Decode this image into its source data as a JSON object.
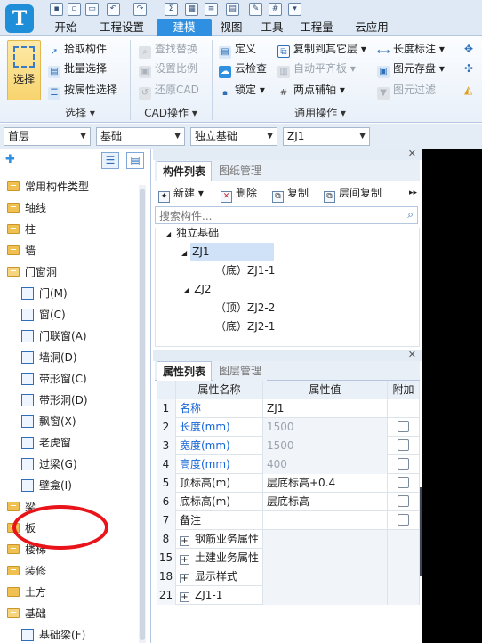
{
  "app": {
    "logo_letter": "T"
  },
  "tabs": [
    {
      "label": "开始"
    },
    {
      "label": "工程设置"
    },
    {
      "label": "建模",
      "active": true
    },
    {
      "label": "视图"
    },
    {
      "label": "工具"
    },
    {
      "label": "工程量"
    },
    {
      "label": "云应用"
    }
  ],
  "ribbon": {
    "select_label": "选择",
    "select_group": {
      "items": [
        "拾取构件",
        "批量选择",
        "按属性选择"
      ],
      "label": "选择"
    },
    "cad_group": {
      "items": [
        "查找替换",
        "设置比例",
        "还原CAD"
      ],
      "label": "CAD操作"
    },
    "common_group": {
      "col1": [
        "定义",
        "云检查",
        "锁定"
      ],
      "col2": [
        "复制到其它层",
        "自动平齐板",
        "两点辅轴"
      ],
      "col3": [
        "长度标注",
        "图元存盘",
        "图元过滤"
      ],
      "label": "通用操作"
    }
  },
  "combos": {
    "floor": "首层",
    "category": "基础",
    "type": "独立基础",
    "element": "ZJ1"
  },
  "left_tree": [
    {
      "label": "常用构件类型",
      "kind": "folder"
    },
    {
      "label": "轴线",
      "kind": "folder"
    },
    {
      "label": "柱",
      "kind": "folder"
    },
    {
      "label": "墙",
      "kind": "folder"
    },
    {
      "label": "门窗洞",
      "kind": "folder-open"
    },
    {
      "label": "门(M)",
      "kind": "child"
    },
    {
      "label": "窗(C)",
      "kind": "child"
    },
    {
      "label": "门联窗(A)",
      "kind": "child"
    },
    {
      "label": "墙洞(D)",
      "kind": "child"
    },
    {
      "label": "带形窗(C)",
      "kind": "child"
    },
    {
      "label": "带形洞(D)",
      "kind": "child"
    },
    {
      "label": "飘窗(X)",
      "kind": "child"
    },
    {
      "label": "老虎窗",
      "kind": "child"
    },
    {
      "label": "过梁(G)",
      "kind": "child"
    },
    {
      "label": "壁龛(I)",
      "kind": "child"
    },
    {
      "label": "梁",
      "kind": "folder"
    },
    {
      "label": "板",
      "kind": "folder"
    },
    {
      "label": "楼梯",
      "kind": "folder"
    },
    {
      "label": "装修",
      "kind": "folder"
    },
    {
      "label": "土方",
      "kind": "folder"
    },
    {
      "label": "基础",
      "kind": "folder-open"
    },
    {
      "label": "基础梁(F)",
      "kind": "child"
    }
  ],
  "component_panel": {
    "tabs": [
      "构件列表",
      "图纸管理"
    ],
    "toolbar": [
      "新建",
      "删除",
      "复制",
      "层间复制"
    ],
    "search_placeholder": "搜索构件...",
    "tree": [
      {
        "label": "独立基础",
        "level": 0
      },
      {
        "label": "ZJ1",
        "level": 1,
        "selected": true
      },
      {
        "label": "（底）ZJ1-1",
        "level": 2
      },
      {
        "label": "ZJ2",
        "level": 1
      },
      {
        "label": "（顶）ZJ2-2",
        "level": 2
      },
      {
        "label": "（底）ZJ2-1",
        "level": 2
      }
    ]
  },
  "property_panel": {
    "tabs": [
      "属性列表",
      "图层管理"
    ],
    "headers": {
      "name": "属性名称",
      "value": "属性值",
      "add": "附加"
    },
    "rows": [
      {
        "num": "1",
        "name": "名称",
        "value": "ZJ1",
        "name_blue": true,
        "value_gray": false,
        "checkbox": false,
        "expandable": false
      },
      {
        "num": "2",
        "name": "长度(mm)",
        "value": "1500",
        "name_blue": true,
        "value_gray": true,
        "checkbox": true,
        "expandable": false
      },
      {
        "num": "3",
        "name": "宽度(mm)",
        "value": "1500",
        "name_blue": true,
        "value_gray": true,
        "checkbox": true,
        "expandable": false
      },
      {
        "num": "4",
        "name": "高度(mm)",
        "value": "400",
        "name_blue": true,
        "value_gray": true,
        "checkbox": true,
        "expandable": false
      },
      {
        "num": "5",
        "name": "顶标高(m)",
        "value": "层底标高+0.4",
        "name_blue": false,
        "value_gray": false,
        "checkbox": true,
        "expandable": false
      },
      {
        "num": "6",
        "name": "底标高(m)",
        "value": "层底标高",
        "name_blue": false,
        "value_gray": false,
        "checkbox": true,
        "expandable": false
      },
      {
        "num": "7",
        "name": "备注",
        "value": "",
        "name_blue": false,
        "value_gray": false,
        "checkbox": true,
        "expandable": false
      },
      {
        "num": "8",
        "name": "钢筋业务属性",
        "value": "",
        "name_blue": false,
        "value_gray": false,
        "checkbox": false,
        "expandable": true
      },
      {
        "num": "15",
        "name": "土建业务属性",
        "value": "",
        "name_blue": false,
        "value_gray": false,
        "checkbox": false,
        "expandable": true
      },
      {
        "num": "18",
        "name": "显示样式",
        "value": "",
        "name_blue": false,
        "value_gray": false,
        "checkbox": false,
        "expandable": true
      },
      {
        "num": "21",
        "name": "ZJ1-1",
        "value": "",
        "name_blue": false,
        "value_gray": false,
        "checkbox": false,
        "expandable": true
      }
    ]
  },
  "colors": {
    "accent": "#2f8fe0",
    "annotation_circle": "#e8141a",
    "link_blue": "#1565d6"
  }
}
